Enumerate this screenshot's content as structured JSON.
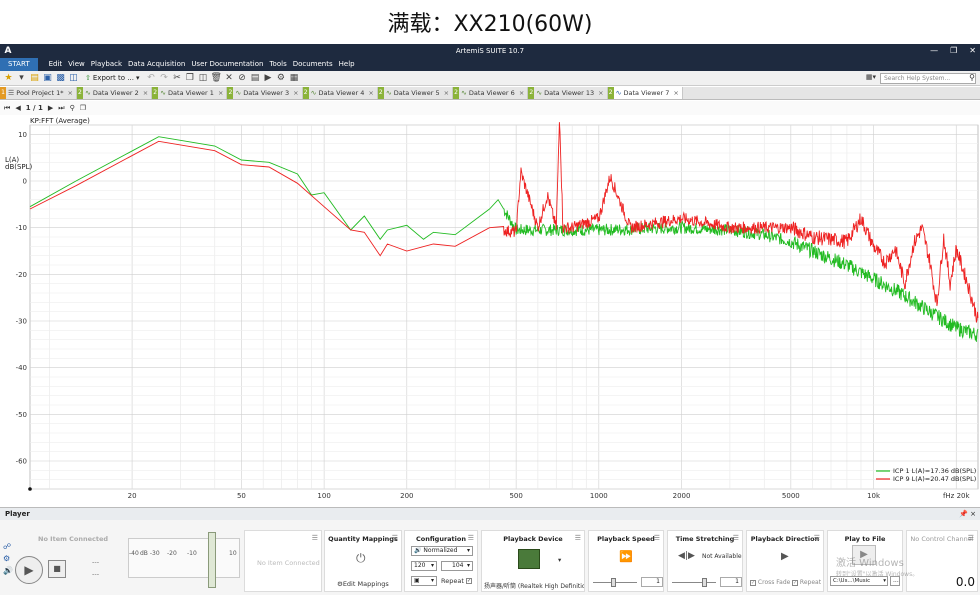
{
  "page_caption": "满载：XX210(60W)",
  "window": {
    "title": "ArtemiS SUITE 10.7",
    "logo": "A"
  },
  "menu": {
    "start": "START",
    "items": [
      "Edit",
      "View",
      "Playback",
      "Data Acquisition",
      "User Documentation",
      "Tools",
      "Documents",
      "Help"
    ]
  },
  "toolbar": {
    "export_label": "Export to ...",
    "search_placeholder": "Search Help System..."
  },
  "tabs": [
    {
      "num": "1",
      "label": "Pool Project 1*",
      "active": false,
      "orange": true
    },
    {
      "num": "2",
      "label": "Data Viewer 2",
      "active": false
    },
    {
      "num": "2",
      "label": "Data Viewer 1",
      "active": false
    },
    {
      "num": "2",
      "label": "Data Viewer 3",
      "active": false
    },
    {
      "num": "2",
      "label": "Data Viewer 4",
      "active": false
    },
    {
      "num": "2",
      "label": "Data Viewer 5",
      "active": false
    },
    {
      "num": "2",
      "label": "Data Viewer 6",
      "active": false
    },
    {
      "num": "2",
      "label": "Data Viewer 13",
      "active": false
    },
    {
      "num": "2",
      "label": "Data Viewer 7",
      "active": true
    }
  ],
  "nav": {
    "page": "1 / 1"
  },
  "chart_data": {
    "type": "line",
    "title": "KP:FFT (Average)",
    "ylabel": "L(A)\ndB(SPL)",
    "xlabel": "",
    "x_scale": "log",
    "xlim": [
      8.5,
      24000
    ],
    "ylim": [
      -66,
      12
    ],
    "x_ticks": [
      20,
      50,
      100,
      200,
      500,
      1000,
      2000,
      5000,
      10000,
      20000
    ],
    "x_tick_labels": [
      "20",
      "50",
      "100",
      "200",
      "500",
      "1000",
      "2000",
      "5000",
      "10k",
      "fHz 20k"
    ],
    "y_ticks": [
      10,
      0,
      -10,
      -20,
      -30,
      -40,
      -50,
      -60
    ],
    "y_tick_labels": [
      "10",
      "0",
      "-10",
      "-20",
      "-30",
      "-40",
      "-50",
      "-60"
    ],
    "grid": true,
    "legend_position": "bottom-right",
    "series": [
      {
        "name": "ICP 1 L(A)=17.36 dB(SPL)",
        "color": "#22bb22",
        "x": [
          8.5,
          12.5,
          25,
          40,
          50,
          63,
          80,
          90,
          100,
          125,
          140,
          160,
          170,
          200,
          230,
          250,
          300,
          400,
          430,
          500,
          700,
          1000,
          2000,
          3000,
          4000,
          5000,
          6000,
          8000,
          10000,
          12500,
          16000,
          20000,
          24000
        ],
        "y": [
          -5.5,
          0,
          9.5,
          7.5,
          4.5,
          4,
          1.5,
          -3,
          -2.5,
          -10.5,
          -7.5,
          -12.5,
          -10.5,
          -9.5,
          -12.5,
          -11.0,
          -11.5,
          -6.0,
          -4.0,
          -10.5,
          -10.5,
          -10.5,
          -10.0,
          -10.5,
          -11.5,
          -13.0,
          -15.0,
          -18.0,
          -21.0,
          -24.0,
          -28.0,
          -31.5,
          -33.0
        ]
      },
      {
        "name": "ICP 9 L(A)=20.47 dB(SPL)",
        "color": "#ee2222",
        "x": [
          8.5,
          12.5,
          25,
          40,
          50,
          63,
          80,
          100,
          125,
          140,
          160,
          170,
          200,
          250,
          300,
          400,
          500,
          520,
          600,
          650,
          700,
          720,
          740,
          800,
          1000,
          1100,
          1300,
          2000,
          3000,
          5000,
          6000,
          8000,
          9000,
          10000,
          11000,
          12000,
          13000,
          14000,
          15000,
          16000,
          17000,
          18000,
          19000,
          20000,
          22000,
          24000
        ],
        "y": [
          -6.0,
          -1,
          8.5,
          6.5,
          3.5,
          3,
          -0.5,
          -5.5,
          -10.5,
          -11.0,
          -16.0,
          -13.5,
          -15.0,
          -13.5,
          -14.0,
          -10.0,
          -11.0,
          2.0,
          -10.0,
          -3.0,
          -10.0,
          14.0,
          -10.0,
          -10.0,
          -8.0,
          1.0,
          -10.0,
          -8.0,
          -10.0,
          -10.0,
          -12.0,
          -13.0,
          -8.0,
          -14.0,
          -17.5,
          -14.5,
          -22.0,
          -13.5,
          -10.0,
          -17.0,
          -26.5,
          -12.0,
          -22.0,
          -14.5,
          -22.0,
          -30.0
        ]
      }
    ]
  },
  "player": {
    "header": "Player",
    "no_item": "No Item Connected",
    "meter_ticks": [
      "-40",
      "dB -30",
      "-20",
      "-10",
      "10"
    ],
    "mappings": {
      "title": "Quantity Mappings",
      "edit_label": "Edit Mappings"
    },
    "configuration": {
      "title": "Configuration",
      "mode": "Normalized",
      "value_a": "120",
      "value_b": "104",
      "repeat_label": "Repeat"
    },
    "device": {
      "title": "Playback Device",
      "device_name": "扬声器/听筒 (Realtek High Definition"
    },
    "speed": {
      "title": "Playback Speed",
      "value": "1"
    },
    "stretch": {
      "title": "Time Stretching",
      "status": "Not Available",
      "value": "1"
    },
    "direction": {
      "title": "Playback Direction",
      "cross_fade": "Cross Fade",
      "repeat": "Repeat"
    },
    "play_to_file": {
      "title": "Play to File",
      "path": "C:\\Us...\\Music"
    },
    "control_channel": {
      "title": "No Control Channel",
      "value": "0.0"
    },
    "watermark": "激活 Windows",
    "watermark_sub": "转到\"设置\"以激活 Windows。"
  }
}
